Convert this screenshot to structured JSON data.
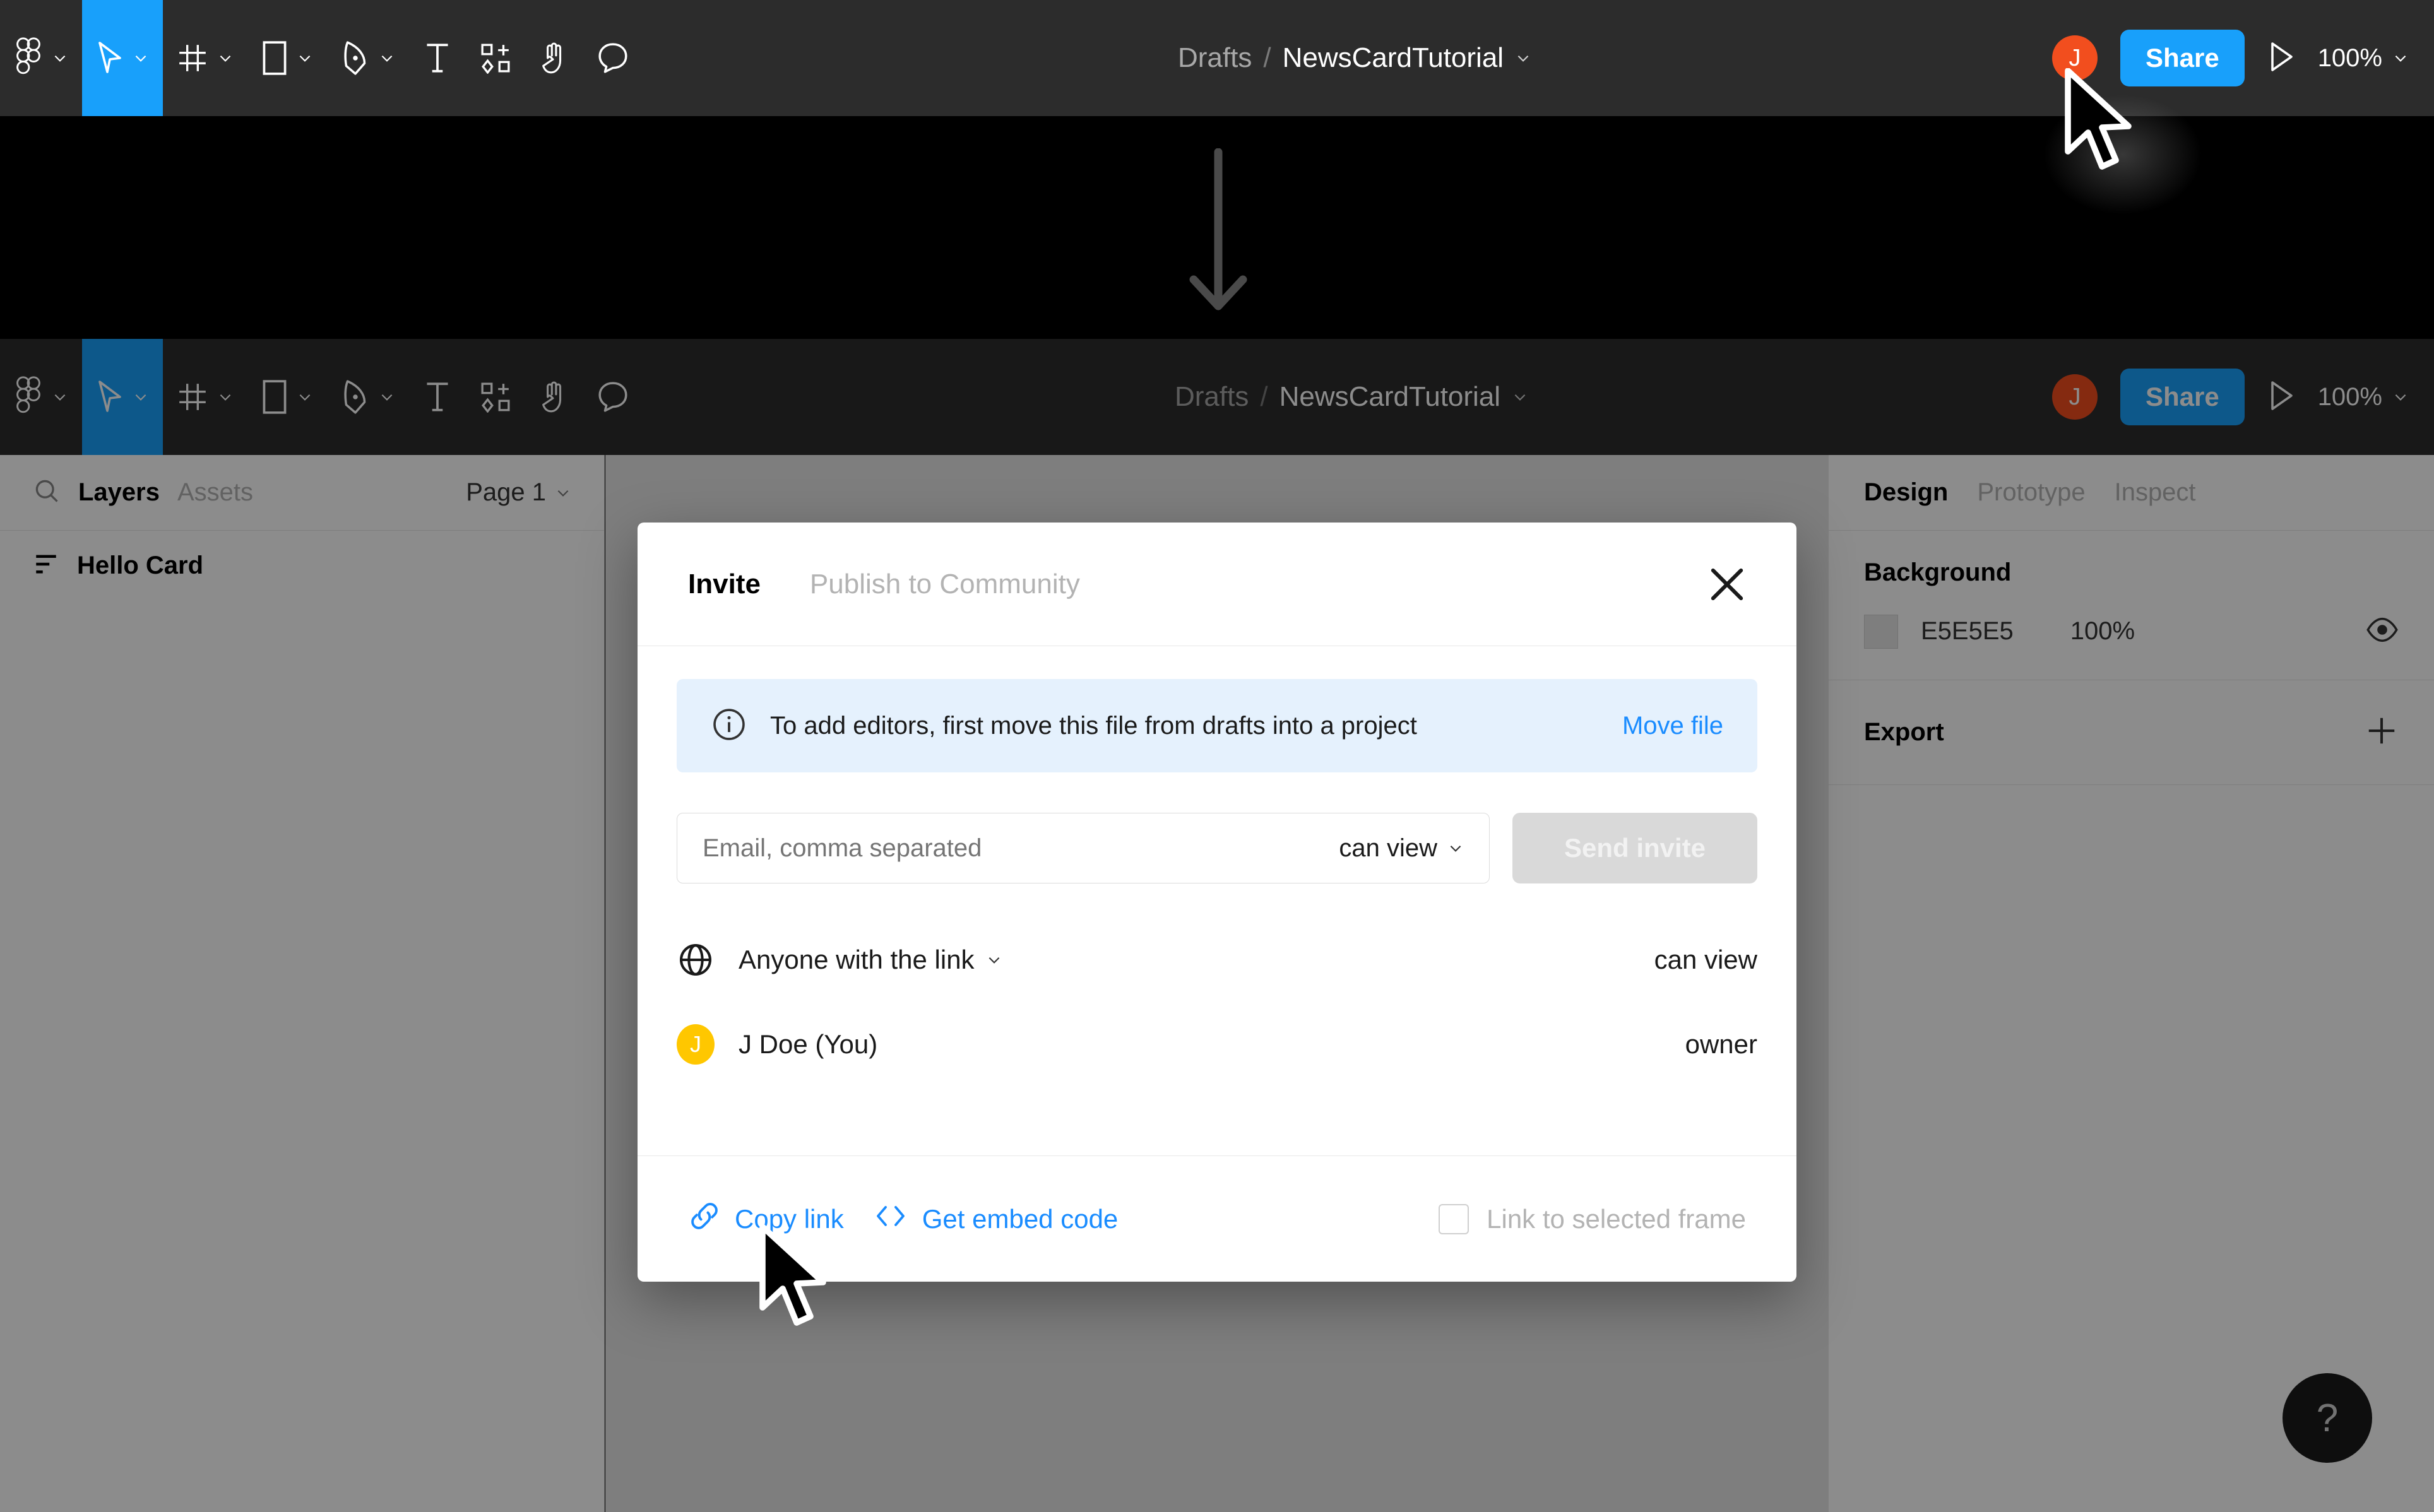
{
  "toolbar": {
    "tools": [
      {
        "name": "figma-menu-icon",
        "label": "Figma menu",
        "caret": true,
        "active": false
      },
      {
        "name": "move-tool-icon",
        "label": "Move",
        "caret": true,
        "active": true
      },
      {
        "name": "frame-tool-icon",
        "label": "Frame",
        "caret": true,
        "active": false
      },
      {
        "name": "shape-tool-icon",
        "label": "Rectangle",
        "caret": true,
        "active": false
      },
      {
        "name": "pen-tool-icon",
        "label": "Pen",
        "caret": true,
        "active": false
      },
      {
        "name": "text-tool-icon",
        "label": "Text",
        "caret": false,
        "active": false
      },
      {
        "name": "resources-tool-icon",
        "label": "Resources",
        "caret": false,
        "active": false
      },
      {
        "name": "hand-tool-icon",
        "label": "Hand",
        "caret": false,
        "active": false
      },
      {
        "name": "comment-tool-icon",
        "label": "Comment",
        "caret": false,
        "active": false
      }
    ],
    "breadcrumb": {
      "project": "Drafts",
      "separator": "/",
      "file": "NewsCardTutorial"
    },
    "avatar_initial": "J",
    "share_label": "Share",
    "present_label": "Present",
    "zoom_level": "100%",
    "accent_blue": "#18a0fb",
    "avatar_color": "#f24e1e"
  },
  "left_panel": {
    "search_icon": "search-icon",
    "tabs": [
      {
        "label": "Layers",
        "selected": true
      },
      {
        "label": "Assets",
        "selected": false
      }
    ],
    "page": "Page 1",
    "layers": [
      {
        "name": "Hello Card",
        "icon": "frame-layer-icon"
      }
    ]
  },
  "right_panel": {
    "tabs": [
      {
        "label": "Design",
        "selected": true
      },
      {
        "label": "Prototype",
        "selected": false
      },
      {
        "label": "Inspect",
        "selected": false
      }
    ],
    "background": {
      "title": "Background",
      "color_hex": "E5E5E5",
      "opacity": "100%",
      "visibility_icon": "eye-icon"
    },
    "export": {
      "title": "Export",
      "add_icon": "plus-icon"
    },
    "help_label": "?"
  },
  "modal": {
    "tabs": [
      {
        "label": "Invite",
        "selected": true
      },
      {
        "label": "Publish to Community",
        "selected": false
      }
    ],
    "close_icon": "close-icon",
    "banner": {
      "icon": "info-icon",
      "text": "To add editors, first move this file from drafts into a project",
      "link_label": "Move file",
      "bg_color": "#e5f1fd",
      "link_color": "#1a8cff"
    },
    "invite": {
      "email_placeholder": "Email, comma separated",
      "email_value": "",
      "permission": "can view",
      "send_label": "Send invite"
    },
    "rows": [
      {
        "icon": "globe-icon",
        "label": "Anyone with the link",
        "has_caret": true,
        "right": "can view",
        "avatar": null
      },
      {
        "icon": "avatar",
        "label": "J Doe (You)",
        "has_caret": false,
        "right": "owner",
        "avatar": {
          "initial": "J",
          "color": "#ffc700"
        }
      }
    ],
    "footer": {
      "copy_link_label": "Copy link",
      "copy_link_icon": "link-icon",
      "embed_label": "Get embed code",
      "embed_icon": "code-icon",
      "checkbox_label": "Link to selected frame",
      "checkbox_checked": false
    }
  },
  "annotation": {
    "arrow": "down-arrow"
  }
}
